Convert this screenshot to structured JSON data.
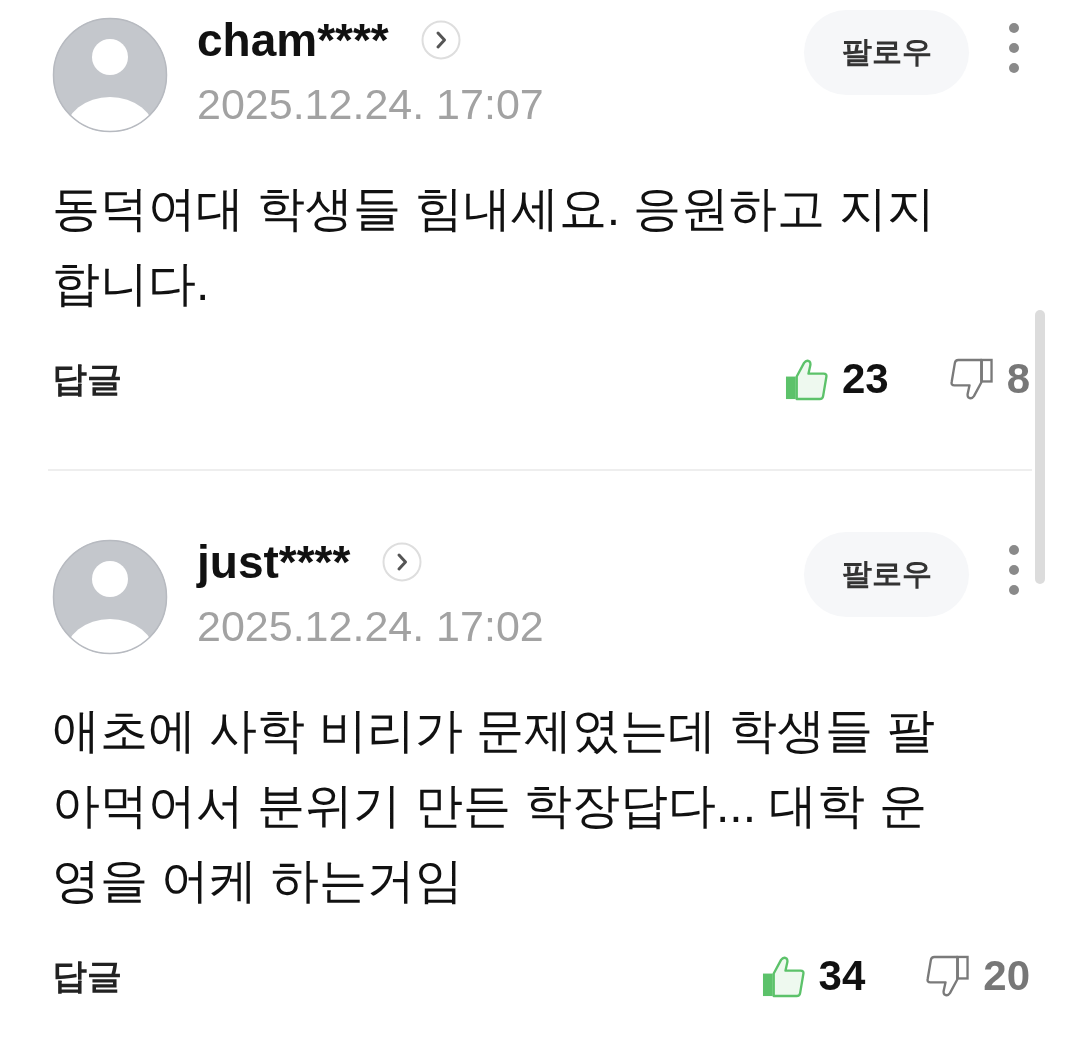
{
  "comments": [
    {
      "author": "cham****",
      "date": "2025.12.24. 17:07",
      "follow_button": "팔로우",
      "text": "동덕여대 학생들 힘내세요. 응원하고 지지합니다.",
      "reply_button": "답글",
      "likes": "23",
      "dislikes": "8"
    },
    {
      "author": "just****",
      "date": "2025.12.24. 17:02",
      "follow_button": "팔로우",
      "text": "애초에 사학 비리가 문제였는데 학생들 팔아먹어서 분위기 만든 학장답다... 대학 운영을 어케 하는거임",
      "reply_button": "답글",
      "likes": "34",
      "dislikes": "20"
    }
  ]
}
